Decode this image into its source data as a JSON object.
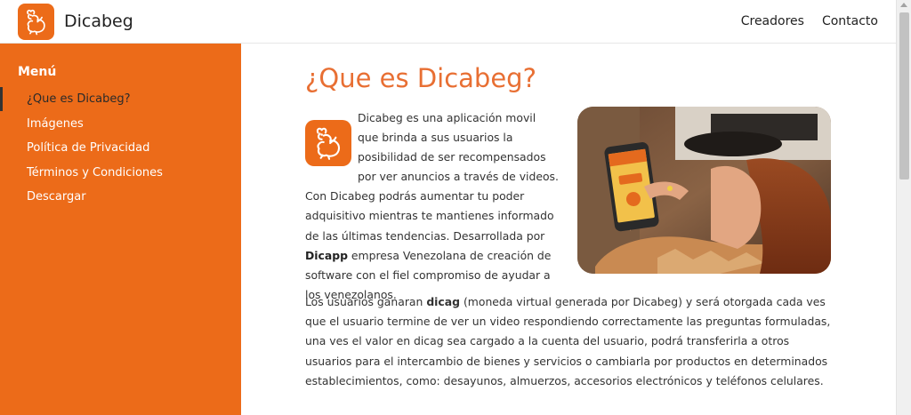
{
  "brand": {
    "name": "Dicabeg",
    "logo_icon": "bird-mascot-icon",
    "accent_color": "#ec6b19"
  },
  "nav": {
    "links": [
      "Creadores",
      "Contacto"
    ]
  },
  "sidebar": {
    "title": "Menú",
    "items": [
      {
        "label": "¿Que es Dicabeg?",
        "active": true
      },
      {
        "label": "Imágenes",
        "active": false
      },
      {
        "label": "Política de Privacidad",
        "active": false
      },
      {
        "label": "Términos y Condiciones",
        "active": false
      },
      {
        "label": "Descargar",
        "active": false
      }
    ]
  },
  "main": {
    "title": "¿Que es Dicabeg?",
    "intro": {
      "before_bold": "Dicabeg es una aplicación movil que brinda a sus usuarios la posibilidad de ser recompensados por ver anuncios a través de videos. Con Dicabeg podrás aumentar tu poder adquisitivo mientras te mantienes informado de las últimas tendencias. Desarrollada por ",
      "bold": "Dicapp",
      "after_bold": " empresa Venezolana de creación de software con el fiel compromiso de ayudar a los venezolanos."
    },
    "second": {
      "before_bold": "Los usuarios ganaran ",
      "bold": "dicag",
      "after_bold": " (moneda virtual generada por Dicabeg) y será otorgada cada ves que el usuario termine de ver un video respondiendo correctamente las preguntas formuladas, una ves el valor en dicag sea cargado a la cuenta del usuario, podrá transferirla a otros usuarios para el intercambio de bienes y servicios o cambiarla por productos en determinados establecimientos, como: desayunos, almuerzos, accesorios electrónicos y teléfonos celulares."
    },
    "photo_icon": "woman-holding-phone-photo"
  }
}
